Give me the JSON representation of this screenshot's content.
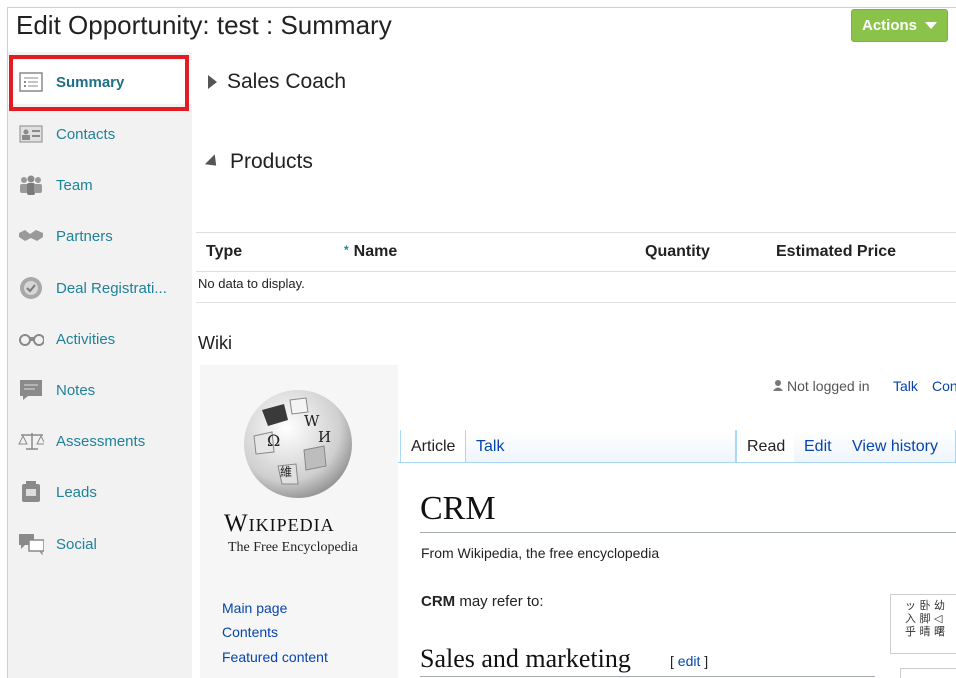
{
  "header": {
    "title": "Edit Opportunity: test : Summary",
    "actions_label": "Actions"
  },
  "sidebar": {
    "items": [
      {
        "label": "Summary",
        "icon": "summary-icon",
        "active": true
      },
      {
        "label": "Contacts",
        "icon": "contact-card-icon"
      },
      {
        "label": "Team",
        "icon": "team-icon"
      },
      {
        "label": "Partners",
        "icon": "handshake-icon"
      },
      {
        "label": "Deal Registrati...",
        "icon": "check-seal-icon"
      },
      {
        "label": "Activities",
        "icon": "binoculars-icon"
      },
      {
        "label": "Notes",
        "icon": "note-icon"
      },
      {
        "label": "Assessments",
        "icon": "scales-icon"
      },
      {
        "label": "Leads",
        "icon": "leads-icon"
      },
      {
        "label": "Social",
        "icon": "chat-bubbles-icon"
      }
    ]
  },
  "main": {
    "sales_coach": "Sales Coach",
    "products": "Products",
    "table": {
      "columns": [
        "Type",
        "Name",
        "Quantity",
        "Estimated Price"
      ],
      "required_marker": "*",
      "empty": "No data to display."
    },
    "wiki_label": "Wiki"
  },
  "wiki": {
    "logo_word": "Wikipedia",
    "tagline": "The Free Encyclopedia",
    "globe_glyphs": [
      "Ω",
      "W",
      "И",
      "維"
    ],
    "nav": [
      "Main page",
      "Contents",
      "Featured content"
    ],
    "user": {
      "not_logged": "Not logged in",
      "talk": "Talk",
      "contrib": "Con"
    },
    "tabs_left": [
      "Article",
      "Talk"
    ],
    "tabs_right": [
      "Read",
      "Edit",
      "View history"
    ],
    "title": "CRM",
    "from": "From Wikipedia, the free encyclopedia",
    "refer_bold": "CRM",
    "refer_rest": " may refer to:",
    "section": "Sales and marketing",
    "section_edit": "edit",
    "side_text": "ッ 卧 幼\n入 脚 ◁\n乎 晴 曙"
  },
  "colors": {
    "accent": "#1f8299",
    "actions_green": "#8bc34a",
    "highlight_red": "#e31b23",
    "wiki_link": "#0645ad"
  }
}
